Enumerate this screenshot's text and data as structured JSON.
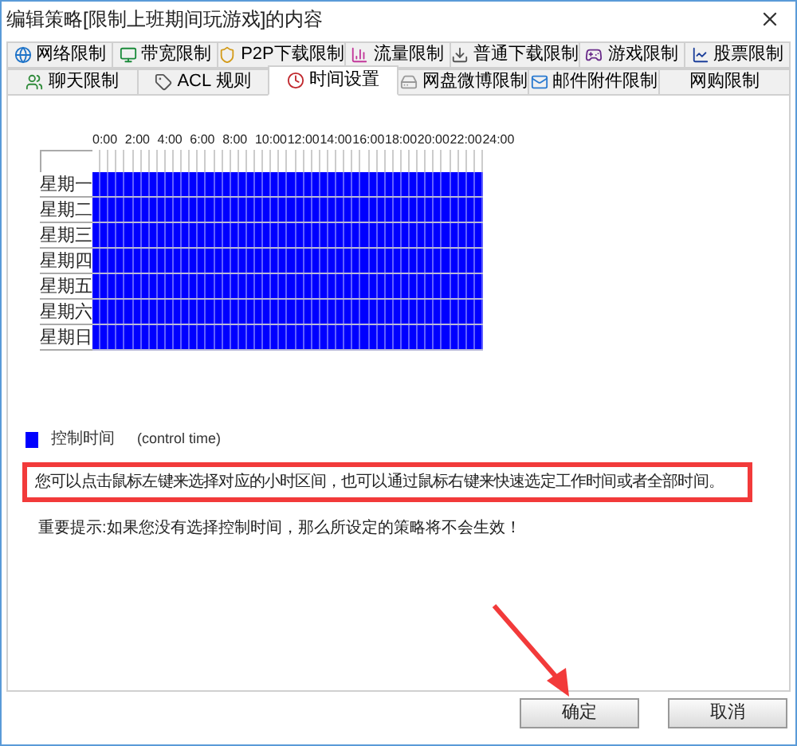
{
  "window": {
    "title": "编辑策略[限制上班期间玩游戏]的内容"
  },
  "tab_rows": [
    [
      {
        "label": "网络限制",
        "selected": false
      },
      {
        "label": "带宽限制",
        "selected": false
      },
      {
        "label": "P2P下载限制",
        "selected": false
      },
      {
        "label": "流量限制",
        "selected": false
      },
      {
        "label": "普通下载限制",
        "selected": false
      },
      {
        "label": "游戏限制",
        "selected": false
      },
      {
        "label": "股票限制",
        "selected": false
      }
    ],
    [
      {
        "label": "聊天限制",
        "selected": false
      },
      {
        "label": "ACL 规则",
        "selected": false
      },
      {
        "label": "时间设置",
        "selected": true
      },
      {
        "label": "网盘微博限制",
        "selected": false
      },
      {
        "label": "邮件附件限制",
        "selected": false
      },
      {
        "label": "网购限制",
        "selected": false
      }
    ]
  ],
  "schedule": {
    "hour_labels": [
      "0:00",
      "2:00",
      "4:00",
      "6:00",
      "8:00",
      "10:00",
      "12:00",
      "14:00",
      "16:00",
      "18:00",
      "20:00",
      "22:00",
      "24:00"
    ],
    "days": [
      {
        "label": "星期一",
        "slots": [
          true,
          true,
          true,
          true,
          true,
          true,
          true,
          true,
          true,
          true,
          true,
          true,
          true,
          true,
          true,
          true,
          true,
          true,
          true,
          true,
          true,
          true,
          true,
          true,
          true,
          true,
          true,
          true,
          true,
          true,
          true,
          true,
          true,
          true,
          true,
          true,
          true,
          true,
          true,
          true,
          true,
          true,
          true,
          true,
          true,
          true,
          true,
          true
        ]
      },
      {
        "label": "星期二",
        "slots": [
          true,
          true,
          true,
          true,
          true,
          true,
          true,
          true,
          true,
          true,
          true,
          true,
          true,
          true,
          true,
          true,
          true,
          true,
          true,
          true,
          true,
          true,
          true,
          true,
          true,
          true,
          true,
          true,
          true,
          true,
          true,
          true,
          true,
          true,
          true,
          true,
          true,
          true,
          true,
          true,
          true,
          true,
          true,
          true,
          true,
          true,
          true,
          true
        ]
      },
      {
        "label": "星期三",
        "slots": [
          true,
          true,
          true,
          true,
          true,
          true,
          true,
          true,
          true,
          true,
          true,
          true,
          true,
          true,
          true,
          true,
          true,
          true,
          true,
          true,
          true,
          true,
          true,
          true,
          true,
          true,
          true,
          true,
          true,
          true,
          true,
          true,
          true,
          true,
          true,
          true,
          true,
          true,
          true,
          true,
          true,
          true,
          true,
          true,
          true,
          true,
          true,
          true
        ]
      },
      {
        "label": "星期四",
        "slots": [
          true,
          true,
          true,
          true,
          true,
          true,
          true,
          true,
          true,
          true,
          true,
          true,
          true,
          true,
          true,
          true,
          true,
          true,
          true,
          true,
          true,
          true,
          true,
          true,
          true,
          true,
          true,
          true,
          true,
          true,
          true,
          true,
          true,
          true,
          true,
          true,
          true,
          true,
          true,
          true,
          true,
          true,
          true,
          true,
          true,
          true,
          true,
          true
        ]
      },
      {
        "label": "星期五",
        "slots": [
          true,
          true,
          true,
          true,
          true,
          true,
          true,
          true,
          true,
          true,
          true,
          true,
          true,
          true,
          true,
          true,
          true,
          true,
          true,
          true,
          true,
          true,
          true,
          true,
          true,
          true,
          true,
          true,
          true,
          true,
          true,
          true,
          true,
          true,
          true,
          true,
          true,
          true,
          true,
          true,
          true,
          true,
          true,
          true,
          true,
          true,
          true,
          true
        ]
      },
      {
        "label": "星期六",
        "slots": [
          true,
          true,
          true,
          true,
          true,
          true,
          true,
          true,
          true,
          true,
          true,
          true,
          true,
          true,
          true,
          true,
          true,
          true,
          true,
          true,
          true,
          true,
          true,
          true,
          true,
          true,
          true,
          true,
          true,
          true,
          true,
          true,
          true,
          true,
          true,
          true,
          true,
          true,
          true,
          true,
          true,
          true,
          true,
          true,
          true,
          true,
          true,
          true
        ]
      },
      {
        "label": "星期日",
        "slots": [
          true,
          true,
          true,
          true,
          true,
          true,
          true,
          true,
          true,
          true,
          true,
          true,
          true,
          true,
          true,
          true,
          true,
          true,
          true,
          true,
          true,
          true,
          true,
          true,
          true,
          true,
          true,
          true,
          true,
          true,
          true,
          true,
          true,
          true,
          true,
          true,
          true,
          true,
          true,
          true,
          true,
          true,
          true,
          true,
          true,
          true,
          true,
          true
        ]
      }
    ]
  },
  "legend": {
    "label": "控制时间",
    "note": "(control time)"
  },
  "hint": "您可以点击鼠标左键来选择对应的小时区间，也可以通过鼠标右键来快速选定工作时间或者全部时间。",
  "warning": "重要提示:如果您没有选择控制时间，那么所设定的策略将不会生效！",
  "buttons": [
    "确定",
    "取消"
  ]
}
